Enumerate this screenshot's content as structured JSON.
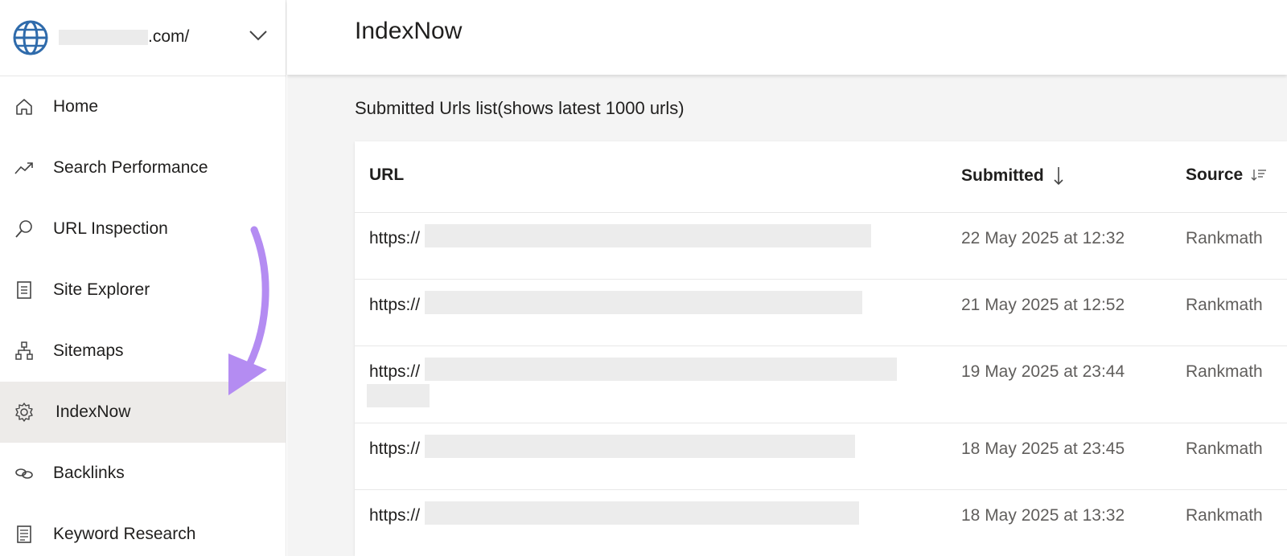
{
  "site": {
    "domain_suffix": ".com/"
  },
  "sidebar": {
    "items": [
      {
        "label": "Home",
        "icon": "home-icon"
      },
      {
        "label": "Search Performance",
        "icon": "trend-icon"
      },
      {
        "label": "URL Inspection",
        "icon": "search-icon"
      },
      {
        "label": "Site Explorer",
        "icon": "document-icon"
      },
      {
        "label": "Sitemaps",
        "icon": "sitemap-icon"
      },
      {
        "label": "IndexNow",
        "icon": "gear-icon",
        "active": true
      },
      {
        "label": "Backlinks",
        "icon": "link-icon"
      },
      {
        "label": "Keyword Research",
        "icon": "list-icon"
      }
    ]
  },
  "main": {
    "title": "IndexNow",
    "caption": "Submitted Urls list(shows latest 1000 urls)",
    "table": {
      "headers": {
        "url": "URL",
        "submitted": "Submitted",
        "source": "Source"
      },
      "rows": [
        {
          "url": "https://",
          "submitted": "22 May 2025 at 12:32",
          "source": "Rankmath"
        },
        {
          "url": "https://",
          "submitted": "21 May 2025 at 12:52",
          "source": "Rankmath"
        },
        {
          "url": "https://",
          "submitted": "19 May 2025 at 23:44",
          "source": "Rankmath"
        },
        {
          "url": "https://",
          "submitted": "18 May 2025 at 23:45",
          "source": "Rankmath"
        },
        {
          "url": "https://",
          "submitted": "18 May 2025 at 13:32",
          "source": "Rankmath"
        }
      ]
    }
  },
  "colors": {
    "annotation_arrow": "#b48cf2",
    "active_bg": "#edebe9",
    "globe": "#2f6bab"
  }
}
